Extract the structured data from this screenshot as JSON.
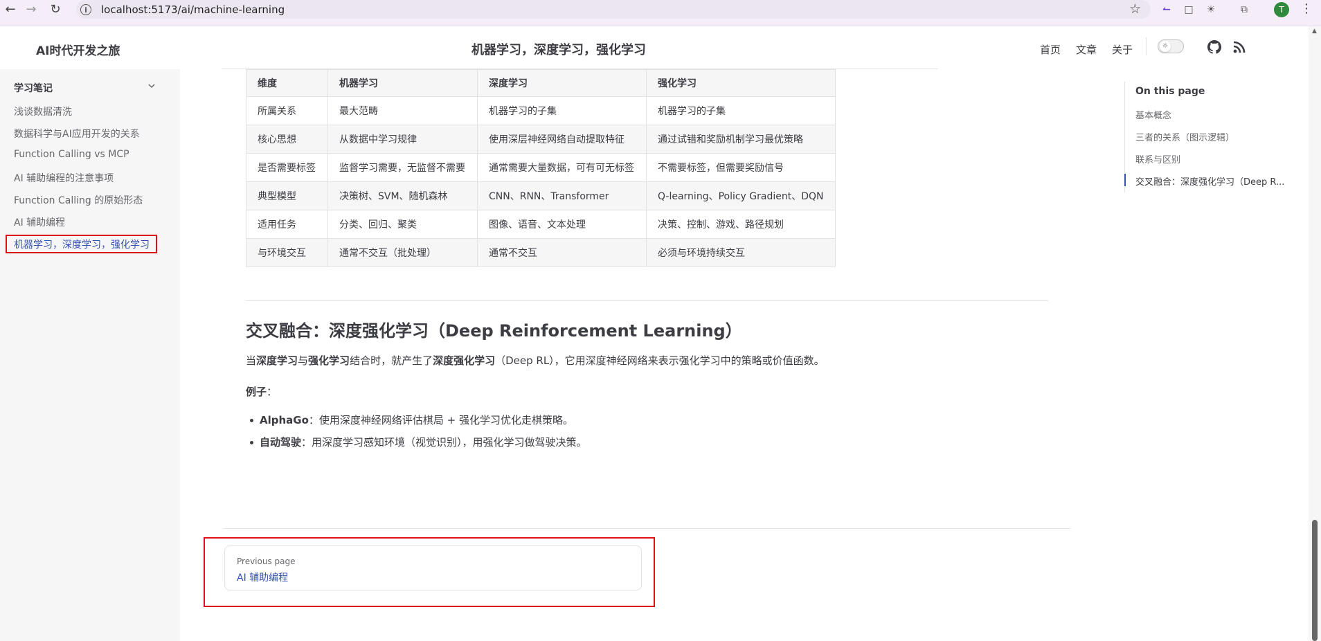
{
  "browser": {
    "url": "localhost:5173/ai/machine-learning",
    "profile_initial": "T"
  },
  "header": {
    "site_title": "AI时代开发之旅",
    "page_heading": "机器学习，深度学习，强化学习",
    "nav": [
      "首页",
      "文章",
      "关于"
    ]
  },
  "sidebar": {
    "group_title": "学习笔记",
    "items": [
      {
        "label": "浅谈数据清洗"
      },
      {
        "label": "数据科学与AI应用开发的关系"
      },
      {
        "label": "Function Calling vs MCP"
      },
      {
        "label": "AI 辅助编程的注意事项"
      },
      {
        "label": "Function Calling 的原始形态"
      },
      {
        "label": "AI 辅助编程"
      },
      {
        "label": "机器学习，深度学习，强化学习",
        "active": true
      }
    ]
  },
  "table": {
    "headers": [
      "维度",
      "机器学习",
      "深度学习",
      "强化学习"
    ],
    "rows": [
      [
        "所属关系",
        "最大范畴",
        "机器学习的子集",
        "机器学习的子集"
      ],
      [
        "核心思想",
        "从数据中学习规律",
        "使用深层神经网络自动提取特征",
        "通过试错和奖励机制学习最优策略"
      ],
      [
        "是否需要标签",
        "监督学习需要，无监督不需要",
        "通常需要大量数据，可有可无标签",
        "不需要标签，但需要奖励信号"
      ],
      [
        "典型模型",
        "决策树、SVM、随机森林",
        "CNN、RNN、Transformer",
        "Q-learning、Policy Gradient、DQN"
      ],
      [
        "适用任务",
        "分类、回归、聚类",
        "图像、语音、文本处理",
        "决策、控制、游戏、路径规划"
      ],
      [
        "与环境交互",
        "通常不交互（批处理）",
        "通常不交互",
        "必须与环境持续交互"
      ]
    ]
  },
  "section": {
    "heading": "交叉融合：深度强化学习（Deep Reinforcement Learning）",
    "para": {
      "p1": "当",
      "b1": "深度学习",
      "p2": "与",
      "b2": "强化学习",
      "p3": "结合时，就产生了",
      "b3": "深度强化学习",
      "p4": "（Deep RL），它用深度神经网络来表示强化学习中的策略或价值函数。"
    },
    "example_label": "例子",
    "example_colon": "：",
    "bullets": [
      {
        "bold": "AlphaGo",
        "text": "：使用深度神经网络评估棋局 + 强化学习优化走棋策略。"
      },
      {
        "bold": "自动驾驶",
        "text": "：用深度学习感知环境（视觉识别），用强化学习做驾驶决策。"
      }
    ]
  },
  "prev_page": {
    "desc": "Previous page",
    "title": "AI 辅助编程"
  },
  "outline": {
    "title": "On this page",
    "links": [
      {
        "label": "基本概念"
      },
      {
        "label": "三者的关系（图示逻辑）"
      },
      {
        "label": "联系与区别"
      },
      {
        "label": "交叉融合：深度强化学习（Deep R...",
        "active": true
      }
    ]
  },
  "colors": {
    "brand": "#3451b2",
    "highlight_box": "#e0101a"
  }
}
